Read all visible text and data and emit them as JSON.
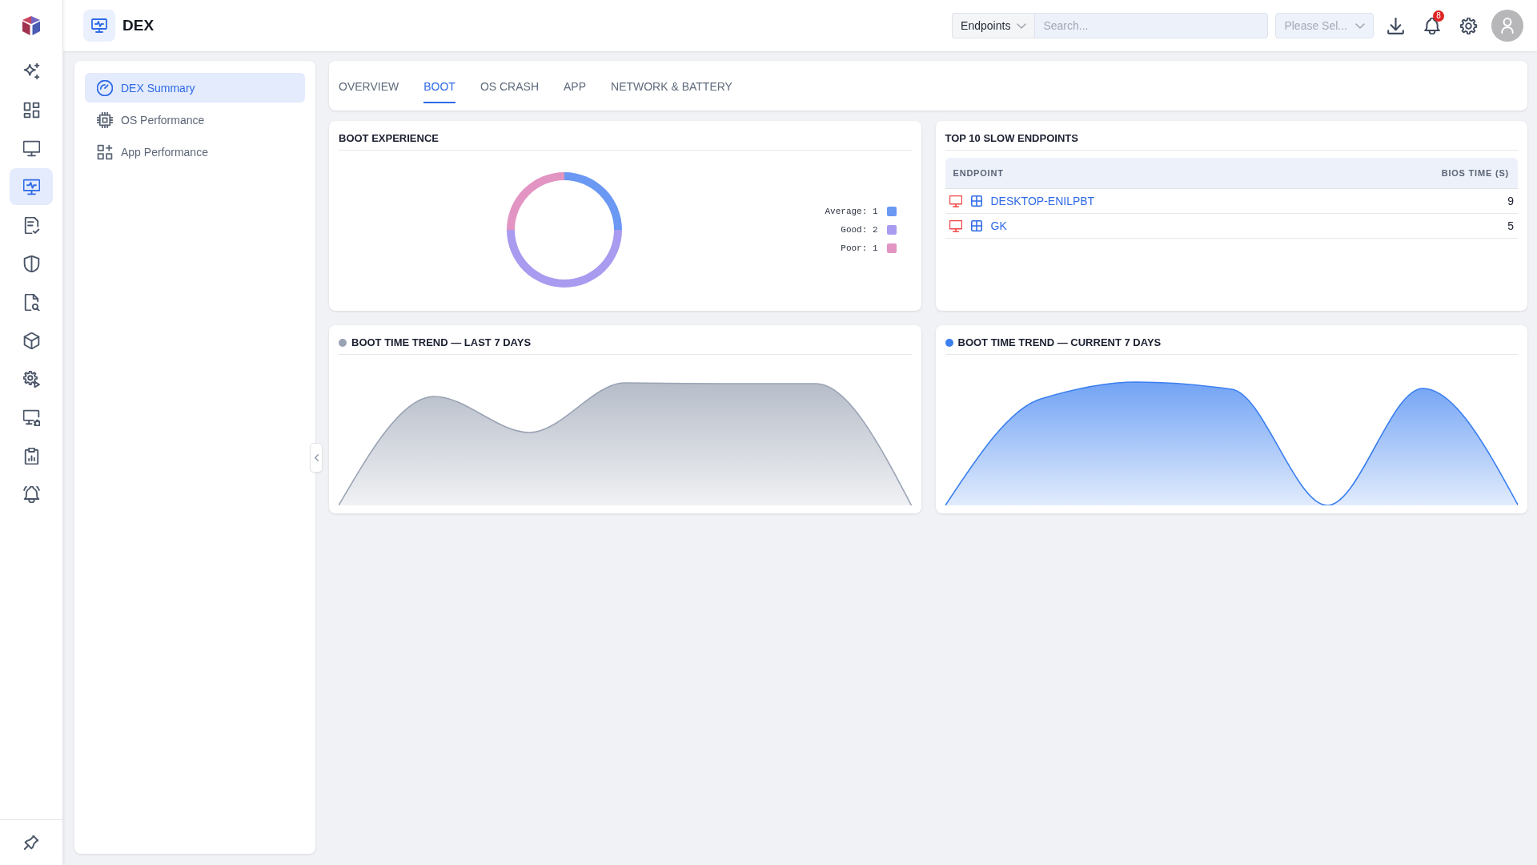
{
  "nav_rail": {
    "items": [
      {
        "selected": false
      },
      {
        "selected": false
      },
      {
        "selected": false
      },
      {
        "selected": true
      },
      {
        "selected": false
      },
      {
        "selected": false
      },
      {
        "selected": false
      },
      {
        "selected": false
      },
      {
        "selected": false
      },
      {
        "selected": false
      },
      {
        "selected": false
      },
      {
        "selected": false
      }
    ]
  },
  "header": {
    "title": "DEX",
    "scope_select": {
      "value": "Endpoints"
    },
    "search": {
      "placeholder": "Search..."
    },
    "filter_select": {
      "placeholder": "Please Sel..."
    },
    "notification_count": "8"
  },
  "sidebar": {
    "items": [
      {
        "label": "DEX Summary",
        "selected": true
      },
      {
        "label": "OS Performance",
        "selected": false
      },
      {
        "label": "App Performance",
        "selected": false
      }
    ]
  },
  "tabs": [
    {
      "label": "OVERVIEW",
      "selected": false
    },
    {
      "label": "BOOT",
      "selected": true
    },
    {
      "label": "OS CRASH",
      "selected": false
    },
    {
      "label": "APP",
      "selected": false
    },
    {
      "label": "NETWORK & BATTERY",
      "selected": false
    }
  ],
  "boot_experience": {
    "title": "BOOT EXPERIENCE",
    "chart_data": {
      "type": "donut",
      "categories": [
        "Average: 1",
        "Good: 2",
        "Poor: 1"
      ],
      "values": [
        1,
        2,
        1
      ],
      "legend": "right"
    },
    "slice_colors": [
      {
        "color": "#6a98f3"
      },
      {
        "color": "#a99bef"
      },
      {
        "color": "#e294c3"
      }
    ]
  },
  "slow_endpoints": {
    "title": "TOP 10 SLOW ENDPOINTS",
    "columns": [
      "ENDPOINT",
      "BIOS TIME (S)"
    ],
    "rows": [
      {
        "endpoint": "DESKTOP-ENILPBT",
        "bios_time": "9",
        "online": false
      },
      {
        "endpoint": "GK",
        "bios_time": "5",
        "online": false
      }
    ]
  },
  "trends": [
    {
      "title": "BOOT TIME TREND — LAST 7 DAYS",
      "color": "#9aa3b4"
    },
    {
      "title": "BOOT TIME TREND — CURRENT 7 DAYS",
      "color": "#3b7ff0"
    }
  ]
}
